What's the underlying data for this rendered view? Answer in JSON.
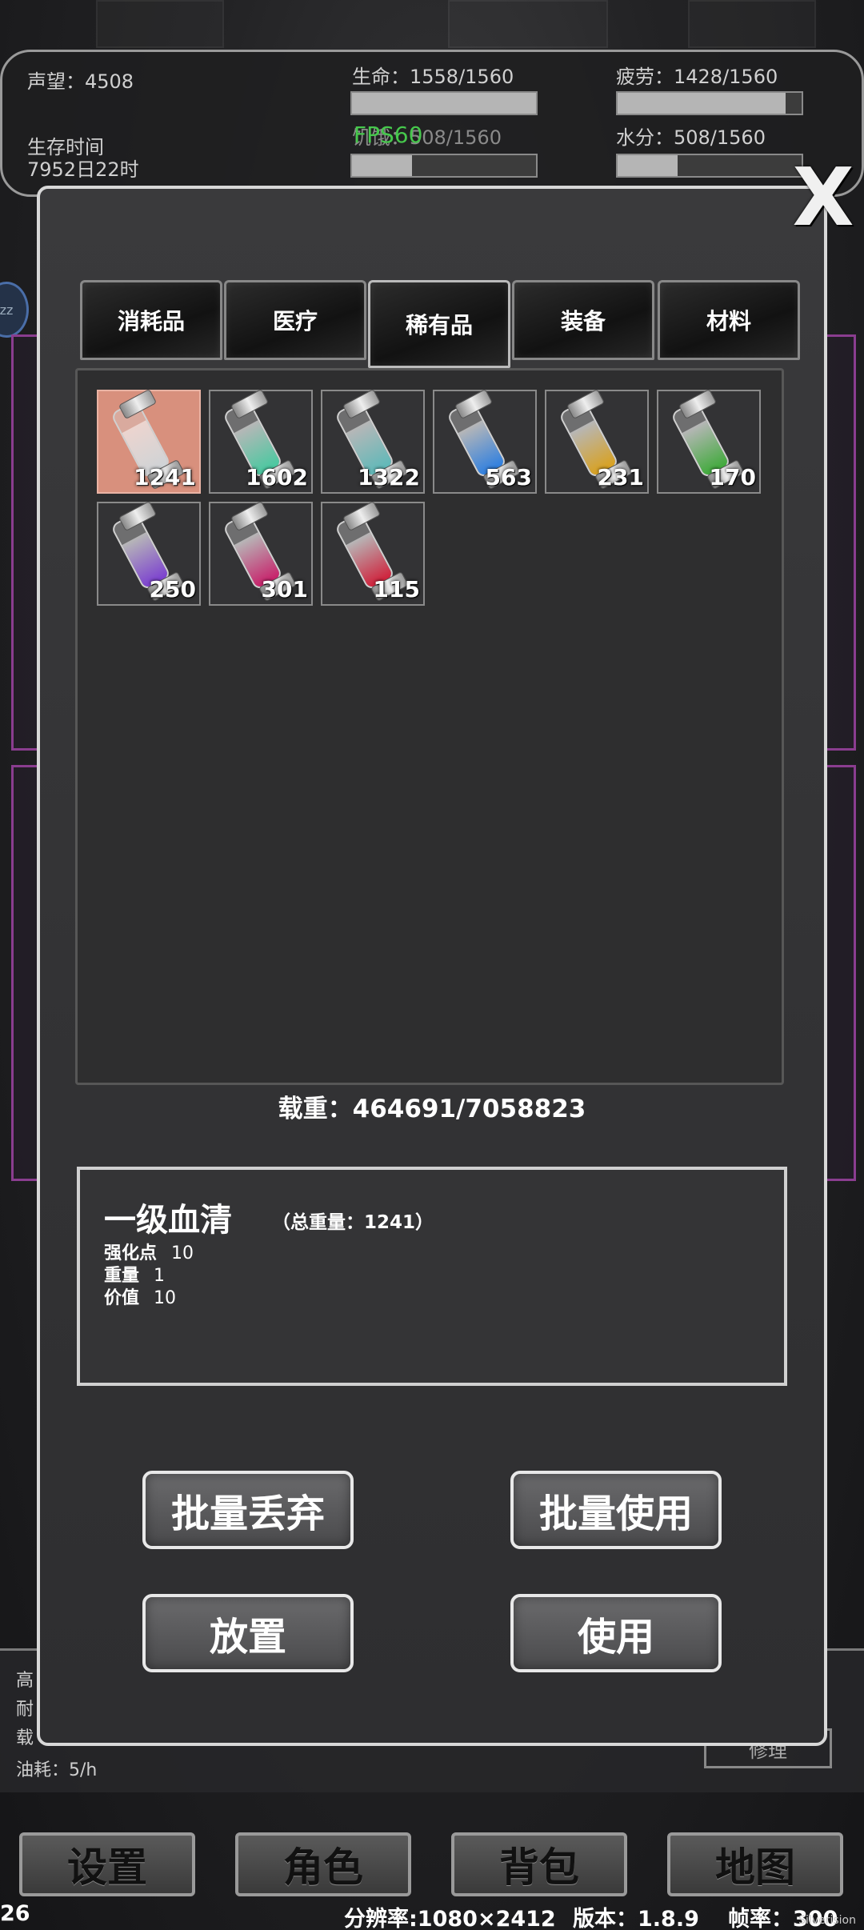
{
  "status": {
    "reputation_label": "声望：4508",
    "survival_label": "生存时间",
    "survival_value": "7952日22时",
    "life_label": "生命：1558/1560",
    "life_pct": 0.999,
    "fatigue_label": "疲劳：1428/1560",
    "fatigue_pct": 0.915,
    "hunger_label": "饥饿：508/1560",
    "hunger_pct": 0.326,
    "water_label": "水分：508/1560",
    "water_pct": 0.326,
    "fps": "FPS60"
  },
  "close_icon": "close-x-icon",
  "tabs": [
    "消耗品",
    "医疗",
    "稀有品",
    "装备",
    "材料"
  ],
  "active_tab": 2,
  "items": [
    {
      "count": "1241",
      "color": "#cfd3d6",
      "selected": true
    },
    {
      "count": "1602",
      "color": "#48c9a0",
      "selected": false
    },
    {
      "count": "1322",
      "color": "#5fb9b9",
      "selected": false
    },
    {
      "count": "563",
      "color": "#2e7fe0",
      "selected": false
    },
    {
      "count": "231",
      "color": "#d9a11e",
      "selected": false
    },
    {
      "count": "170",
      "color": "#3faa3a",
      "selected": false
    },
    {
      "count": "250",
      "color": "#7b3fd0",
      "selected": false
    },
    {
      "count": "301",
      "color": "#c8206a",
      "selected": false
    },
    {
      "count": "115",
      "color": "#d0203a",
      "selected": false
    }
  ],
  "weight_label": "载重：464691/7058823",
  "detail": {
    "name": "一级血清",
    "total_weight": "（总重量：1241）",
    "rows": [
      {
        "label": "强化点",
        "value": "10"
      },
      {
        "label": "重量",
        "value": "1"
      },
      {
        "label": "价值",
        "value": "10"
      }
    ]
  },
  "actions": {
    "batch_drop": "批量丢弃",
    "batch_use": "批量使用",
    "place": "放置",
    "use": "使用"
  },
  "vehicle": {
    "row1": "高",
    "row2": "耐",
    "row3": "载",
    "fuel": "油耗：5/h",
    "repair": "修理"
  },
  "nav": [
    "设置",
    "角色",
    "背包",
    "地图"
  ],
  "footer": {
    "left": "26",
    "resolution": "分辨率:1080×2412",
    "version": "版本：1.8.9",
    "framerate": "帧率：300",
    "corner": "Silverision"
  }
}
